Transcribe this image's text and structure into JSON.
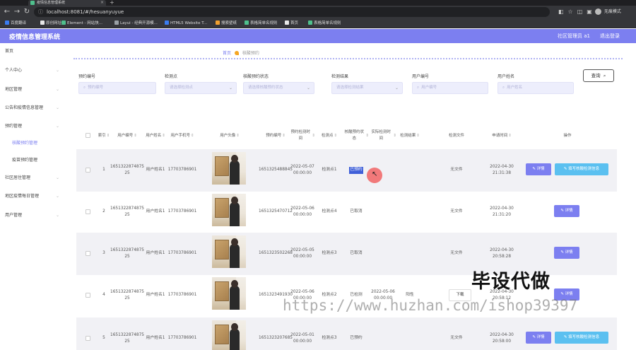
{
  "browser": {
    "tab_title": "疫情信息管理系统",
    "url": "localhost:8081/#/hesuanyuyue",
    "profile": "无痕模式",
    "bookmarks": [
      "百度翻译",
      "原创网址",
      "Element - 网站快...",
      "Layui - 经典开源模...",
      "HTML5 Website T...",
      "搜索壁纸",
      "表格简单名规则",
      "首页",
      "表格简单名规则"
    ]
  },
  "header": {
    "title": "疫情信息管理系统",
    "user": "社区管理员 a1",
    "logout": "退出登录"
  },
  "sidebar": {
    "items": [
      {
        "label": "首页",
        "chevron": false,
        "sub": false,
        "active": false
      },
      {
        "label": "个人中心",
        "chevron": true,
        "sub": false,
        "active": false
      },
      {
        "label": "地区管理",
        "chevron": true,
        "sub": false,
        "active": false
      },
      {
        "label": "公告和疫情信息管理",
        "chevron": true,
        "sub": false,
        "active": false
      },
      {
        "label": "预约管理",
        "chevron": true,
        "sub": false,
        "active": false
      },
      {
        "label": "核酸预约管理",
        "chevron": false,
        "sub": true,
        "active": true
      },
      {
        "label": "疫苗预约管理",
        "chevron": false,
        "sub": true,
        "active": false
      },
      {
        "label": "社区居住管理",
        "chevron": true,
        "sub": false,
        "active": false
      },
      {
        "label": "地区疫情每日管理",
        "chevron": true,
        "sub": false,
        "active": false
      },
      {
        "label": "用户管理",
        "chevron": true,
        "sub": false,
        "active": false
      }
    ]
  },
  "breadcrumb": {
    "home": "首页",
    "current": "核酸预约"
  },
  "search": {
    "fields": [
      {
        "label": "预约编号",
        "placeholder": "预约编号",
        "type": "text"
      },
      {
        "label": "检测点",
        "placeholder": "请选择检测点",
        "type": "select"
      },
      {
        "label": "核酸预约状态",
        "placeholder": "请选择核酸预约状态",
        "type": "select"
      },
      {
        "label": "检测结果",
        "placeholder": "请选择检测结果",
        "type": "select"
      },
      {
        "label": "用户编号",
        "placeholder": "用户编号",
        "type": "text"
      },
      {
        "label": "用户姓名",
        "placeholder": "用户姓名",
        "type": "text"
      }
    ],
    "button": "查询"
  },
  "table": {
    "columns": [
      "索引",
      "用户编号",
      "用户姓名",
      "用户手机号",
      "用户头像",
      "预约编号",
      "预约检测时间",
      "检测点",
      "核酸预约状态",
      "实际检测时间",
      "检测结果",
      "检测文件",
      "申请时间",
      "操作"
    ],
    "rows": [
      {
        "index": "1",
        "user_no": "1651322874875 25",
        "user_name": "用户姓名1",
        "phone": "17703786901",
        "order_no": "1651325488845",
        "book_time": "2022-05-07 00:00:00",
        "site": "检测点1",
        "status": "已预约",
        "status_highlight": true,
        "actual_time": "",
        "result": "",
        "file": "无文件",
        "apply_time": "2022-04-30 21:31:38",
        "detail": "详情",
        "fill": "填写核酸检测信息",
        "download": ""
      },
      {
        "index": "2",
        "user_no": "1651322874875 25",
        "user_name": "用户姓名1",
        "phone": "17703786901",
        "order_no": "1651325470712",
        "book_time": "2022-05-06 00:00:00",
        "site": "检测点4",
        "status": "已取消",
        "status_highlight": false,
        "actual_time": "",
        "result": "",
        "file": "无文件",
        "apply_time": "2022-04-30 21:31:20",
        "detail": "详情",
        "fill": "",
        "download": ""
      },
      {
        "index": "3",
        "user_no": "1651322874875 25",
        "user_name": "用户姓名1",
        "phone": "17703786901",
        "order_no": "1651323502268",
        "book_time": "2022-05-05 00:00:00",
        "site": "检测点3",
        "status": "已取消",
        "status_highlight": false,
        "actual_time": "",
        "result": "",
        "file": "无文件",
        "apply_time": "2022-04-30 20:58:28",
        "detail": "详情",
        "fill": "",
        "download": ""
      },
      {
        "index": "4",
        "user_no": "1651322874875 25",
        "user_name": "用户姓名1",
        "phone": "17703786901",
        "order_no": "1651323491930",
        "book_time": "2022-05-06 00:00:00",
        "site": "检测点2",
        "status": "已检测",
        "status_highlight": false,
        "actual_time": "2022-05-06 00:00:00",
        "result": "阳性",
        "file": "",
        "apply_time": "2022-04-30 20:58:12",
        "detail": "详情",
        "fill": "",
        "download": "下载"
      },
      {
        "index": "5",
        "user_no": "1651322874875 25",
        "user_name": "用户姓名1",
        "phone": "17703786901",
        "order_no": "1651323207685",
        "book_time": "2022-05-01 00:00:00",
        "site": "检测点3",
        "status": "已预约",
        "status_highlight": false,
        "actual_time": "",
        "result": "",
        "file": "无文件",
        "apply_time": "2022-04-30 20:58:00",
        "detail": "详情",
        "fill": "填写核酸检测信息",
        "download": ""
      }
    ]
  },
  "watermark": {
    "text": "毕设代做",
    "url": "https://www.huzhan.com/ishop39397"
  },
  "colors": {
    "accent": "#7c7ff0",
    "fill_button": "#5bc0f0",
    "row_alt": "#f1f1f5"
  }
}
